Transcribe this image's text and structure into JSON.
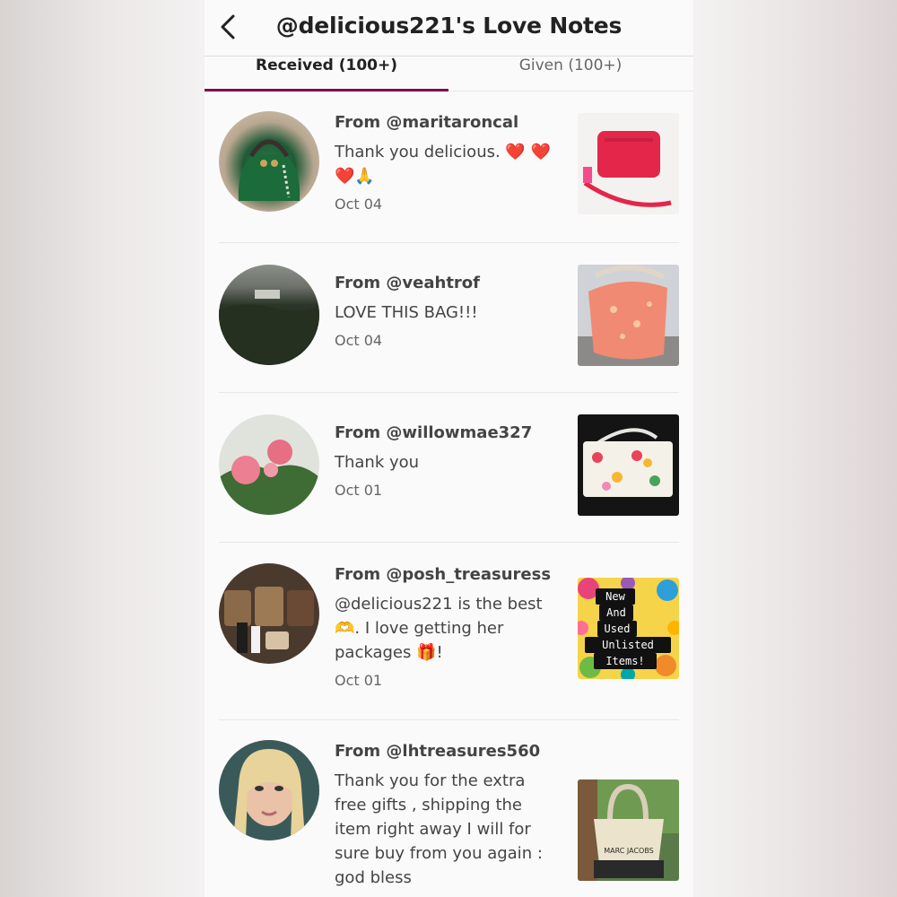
{
  "header": {
    "title": "@delicious221's Love Notes",
    "back_icon": "chevron-left-icon"
  },
  "tabs": [
    {
      "label": "Received (100+)",
      "active": true
    },
    {
      "label": "Given (100+)",
      "active": false
    }
  ],
  "accent_color": "#7f0353",
  "notes": [
    {
      "from": "From @maritaroncal",
      "message": "Thank you delicious. ❤️ ❤️❤️🙏",
      "date": "Oct 04"
    },
    {
      "from": "From @veahtrof",
      "message": "LOVE THIS BAG!!!",
      "date": "Oct 04"
    },
    {
      "from": "From @willowmae327",
      "message": "Thank you",
      "date": "Oct 01"
    },
    {
      "from": "From @posh_treasuress",
      "message": "@delicious221 is the best 🫶. I love getting her packages 🎁!",
      "date": "Oct 01"
    },
    {
      "from": "From @lhtreasures560",
      "message": "Thank you for the extra free gifts , shipping the item right away I will for sure buy from you again : god bless",
      "date": ""
    }
  ],
  "thumbnails": {
    "sticker_text": [
      "New",
      "And",
      "Used",
      "Unlisted",
      "Items!"
    ],
    "bag_brand": "MARC JACOBS"
  }
}
